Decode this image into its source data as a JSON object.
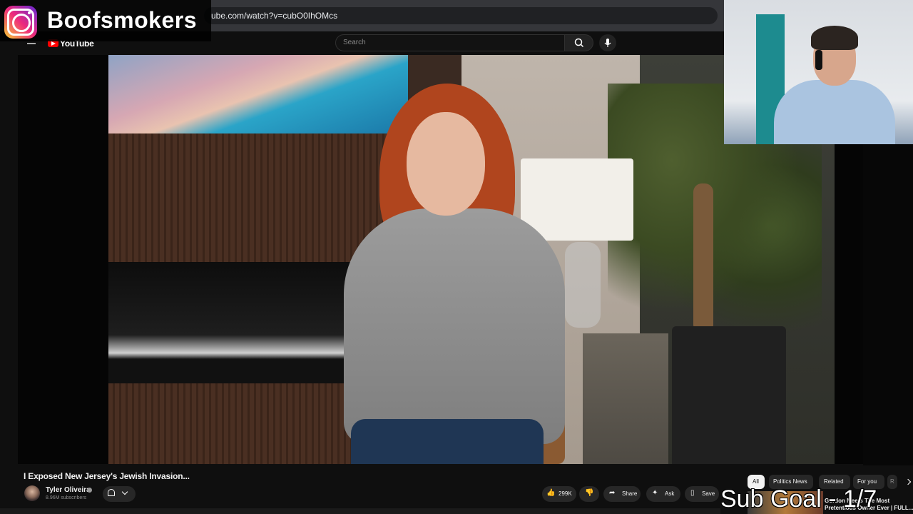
{
  "browser": {
    "url": "ube.com/watch?v=cubO0IhOMcs"
  },
  "overlay": {
    "instagram_handle": "Boofsmokers",
    "sub_goal": "Sub Goal - 1/7"
  },
  "youtube": {
    "logo_text": "YouTube",
    "search_placeholder": "Search",
    "video_title": "I Exposed New Jersey's Jewish Invasion...",
    "channel": {
      "name": "Tyler Oliveira",
      "subscribers": "8.96M subscribers"
    },
    "actions": {
      "likes": "299K",
      "share": "Share",
      "ask": "Ask",
      "save": "Save"
    },
    "chips": [
      "All",
      "Politics News",
      "Related",
      "For you",
      "R"
    ],
    "recommended": {
      "title_line1": "Gordon Meets The Most",
      "title_line2": "Pretentious Owner Ever | FULL..."
    }
  },
  "colors": {
    "yt_red": "#ff0000",
    "background": "#0f0f0f",
    "chip_active": "#f1f1f1"
  }
}
